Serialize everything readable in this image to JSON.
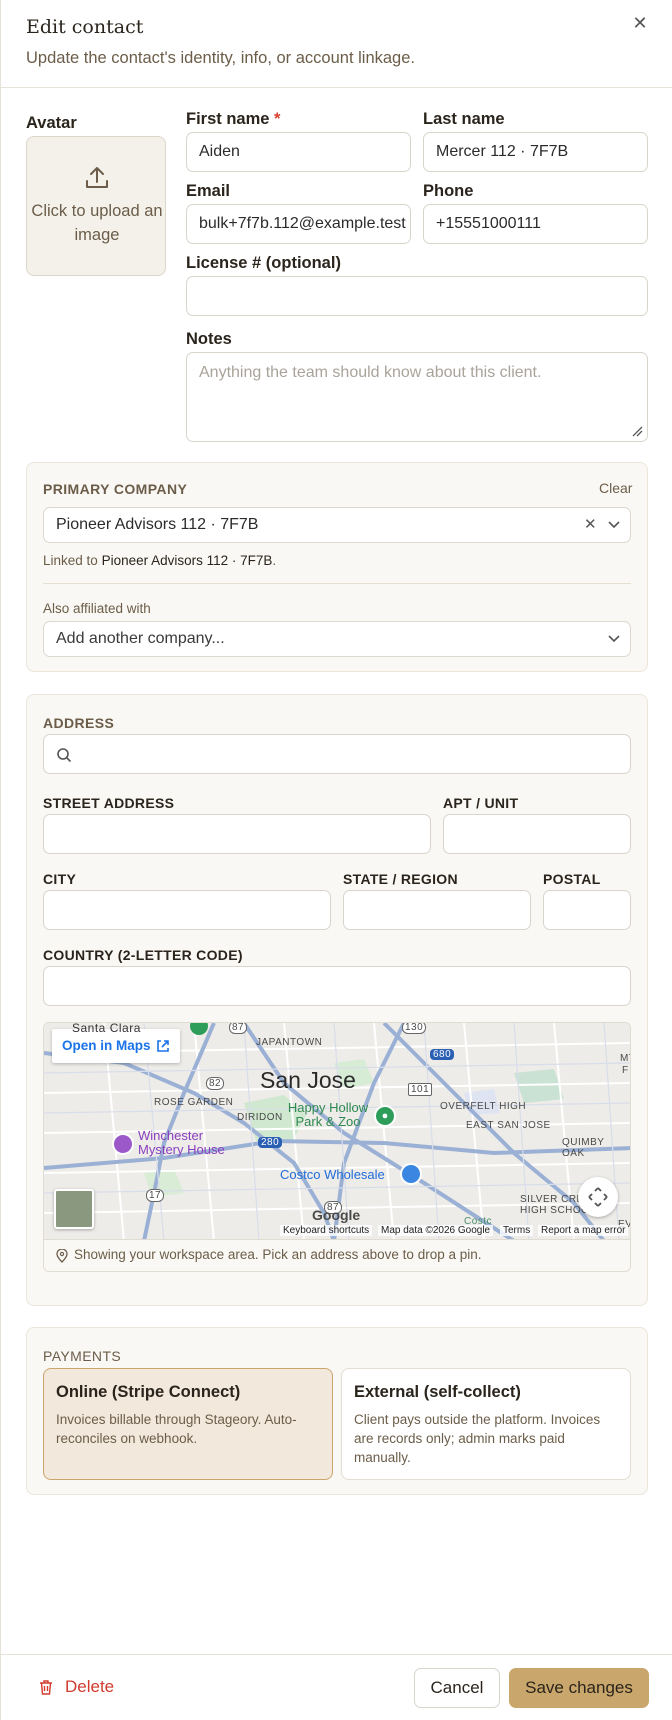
{
  "header": {
    "title": "Edit contact",
    "subtitle": "Update the contact's identity, info, or account linkage.",
    "close_icon": "close-icon"
  },
  "avatar": {
    "label": "Avatar",
    "upload_text": "Click to upload an image",
    "icon": "upload-icon"
  },
  "fields": {
    "first_name": {
      "label": "First name",
      "required_mark": "*",
      "value": "Aiden"
    },
    "last_name": {
      "label": "Last name",
      "value": "Mercer 112 · 7F7B"
    },
    "email": {
      "label": "Email",
      "value": "bulk+7f7b.112@example.test"
    },
    "phone": {
      "label": "Phone",
      "value": "+15551000111"
    },
    "license": {
      "label": "License # (optional)",
      "value": ""
    },
    "notes": {
      "label": "Notes",
      "placeholder": "Anything the team should know about this client.",
      "value": ""
    }
  },
  "company": {
    "heading": "PRIMARY COMPANY",
    "clear_label": "Clear",
    "selected": "Pioneer Advisors 112 · 7F7B",
    "linked_prefix": "Linked to",
    "linked_name": "Pioneer Advisors 112 · 7F7B",
    "linked_suffix": ".",
    "also_label": "Also affiliated with",
    "also_placeholder": "Add another company..."
  },
  "address": {
    "heading": "ADDRESS",
    "search_value": "",
    "street_label": "STREET ADDRESS",
    "apt_label": "APT / UNIT",
    "city_label": "CITY",
    "state_label": "STATE / REGION",
    "postal_label": "POSTAL",
    "country_label": "COUNTRY (2-LETTER CODE)",
    "street": "",
    "apt": "",
    "city": "",
    "state": "",
    "postal": "",
    "country": ""
  },
  "map": {
    "open_in_maps": "Open in Maps",
    "city": "San Jose",
    "labels": {
      "santa_clara": "Santa Clara",
      "japantown": "JAPANTOWN",
      "rose_garden": "ROSE GARDEN",
      "diridon": "DIRIDON",
      "overfelt": "OVERFELT HIGH",
      "east_san_jose": "EAST SAN JOSE",
      "quimby_oak": "QUIMBY OAK",
      "silver_creek": "SILVER CREEK",
      "high_school": "HIGH SCHOOL",
      "mt": "MT",
      "f": "F",
      "ev": "EV",
      "costco_short": "Costc"
    },
    "pois": {
      "happy_hollow": "Happy Hollow Park & Zoo",
      "winchester": "Winchester Mystery House",
      "costco": "Costco Wholesale"
    },
    "shields": {
      "r87": "87",
      "r130": "130",
      "r680": "680",
      "r82": "82",
      "r101": "101",
      "r280": "280",
      "r17": "17",
      "r87b": "87"
    },
    "attribution": {
      "google": "Google",
      "keyboard": "Keyboard shortcuts",
      "data": "Map data ©2026 Google",
      "terms": "Terms",
      "report": "Report a map error"
    },
    "footer_text": "Showing your workspace area. Pick an address above to drop a pin."
  },
  "payments": {
    "heading": "PAYMENTS",
    "options": [
      {
        "title": "Online (Stripe Connect)",
        "desc": "Invoices billable through Stageory. Auto-reconciles on webhook.",
        "selected": true
      },
      {
        "title": "External (self-collect)",
        "desc": "Client pays outside the platform. Invoices are records only; admin marks paid manually.",
        "selected": false
      }
    ]
  },
  "footer": {
    "delete_label": "Delete",
    "cancel_label": "Cancel",
    "save_label": "Save changes"
  },
  "colors": {
    "accent": "#c9a66b",
    "danger": "#d23b2e",
    "selected_card": "#f3e8dc"
  }
}
